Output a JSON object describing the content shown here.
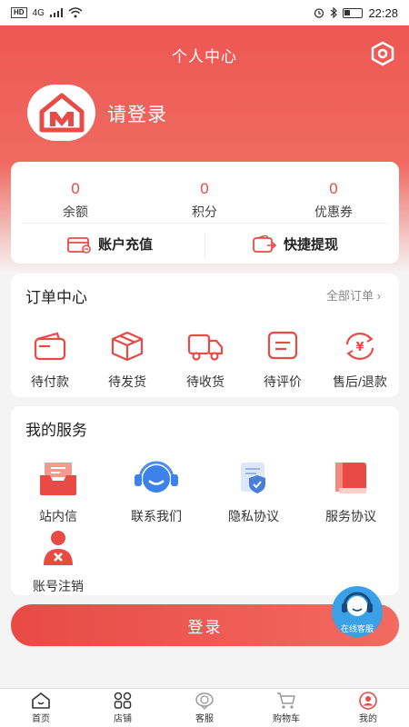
{
  "status_bar": {
    "hd": "HD",
    "network": "4G",
    "time": "22:28"
  },
  "header": {
    "title": "个人中心",
    "login_prompt": "请登录"
  },
  "account": {
    "stats": [
      {
        "value": "0",
        "label": "余额"
      },
      {
        "value": "0",
        "label": "积分"
      },
      {
        "value": "0",
        "label": "优惠券"
      }
    ],
    "actions": [
      {
        "label": "账户充值"
      },
      {
        "label": "快捷提现"
      }
    ]
  },
  "orders": {
    "title": "订单中心",
    "all_label": "全部订单",
    "items": [
      {
        "label": "待付款",
        "icon": "wallet-icon"
      },
      {
        "label": "待发货",
        "icon": "package-icon"
      },
      {
        "label": "待收货",
        "icon": "truck-icon"
      },
      {
        "label": "待评价",
        "icon": "comment-icon"
      },
      {
        "label": "售后/退款",
        "icon": "refund-icon"
      }
    ]
  },
  "services": {
    "title": "我的服务",
    "items": [
      {
        "label": "站内信",
        "icon": "inbox-icon"
      },
      {
        "label": "联系我们",
        "icon": "headset-icon"
      },
      {
        "label": "隐私协议",
        "icon": "shield-document-icon"
      },
      {
        "label": "服务协议",
        "icon": "book-icon"
      },
      {
        "label": "账号注销",
        "icon": "user-remove-icon"
      }
    ]
  },
  "login_button": "登录",
  "online_service": "在线客服",
  "tabs": [
    {
      "label": "首页",
      "icon": "home-icon"
    },
    {
      "label": "店铺",
      "icon": "grid-icon"
    },
    {
      "label": "客服",
      "icon": "service-icon"
    },
    {
      "label": "购物车",
      "icon": "cart-icon"
    },
    {
      "label": "我的",
      "icon": "profile-icon",
      "active": true
    }
  ],
  "colors": {
    "accent": "#e84a46",
    "hero": "#ec5450",
    "fab": "#3aa0e8"
  }
}
